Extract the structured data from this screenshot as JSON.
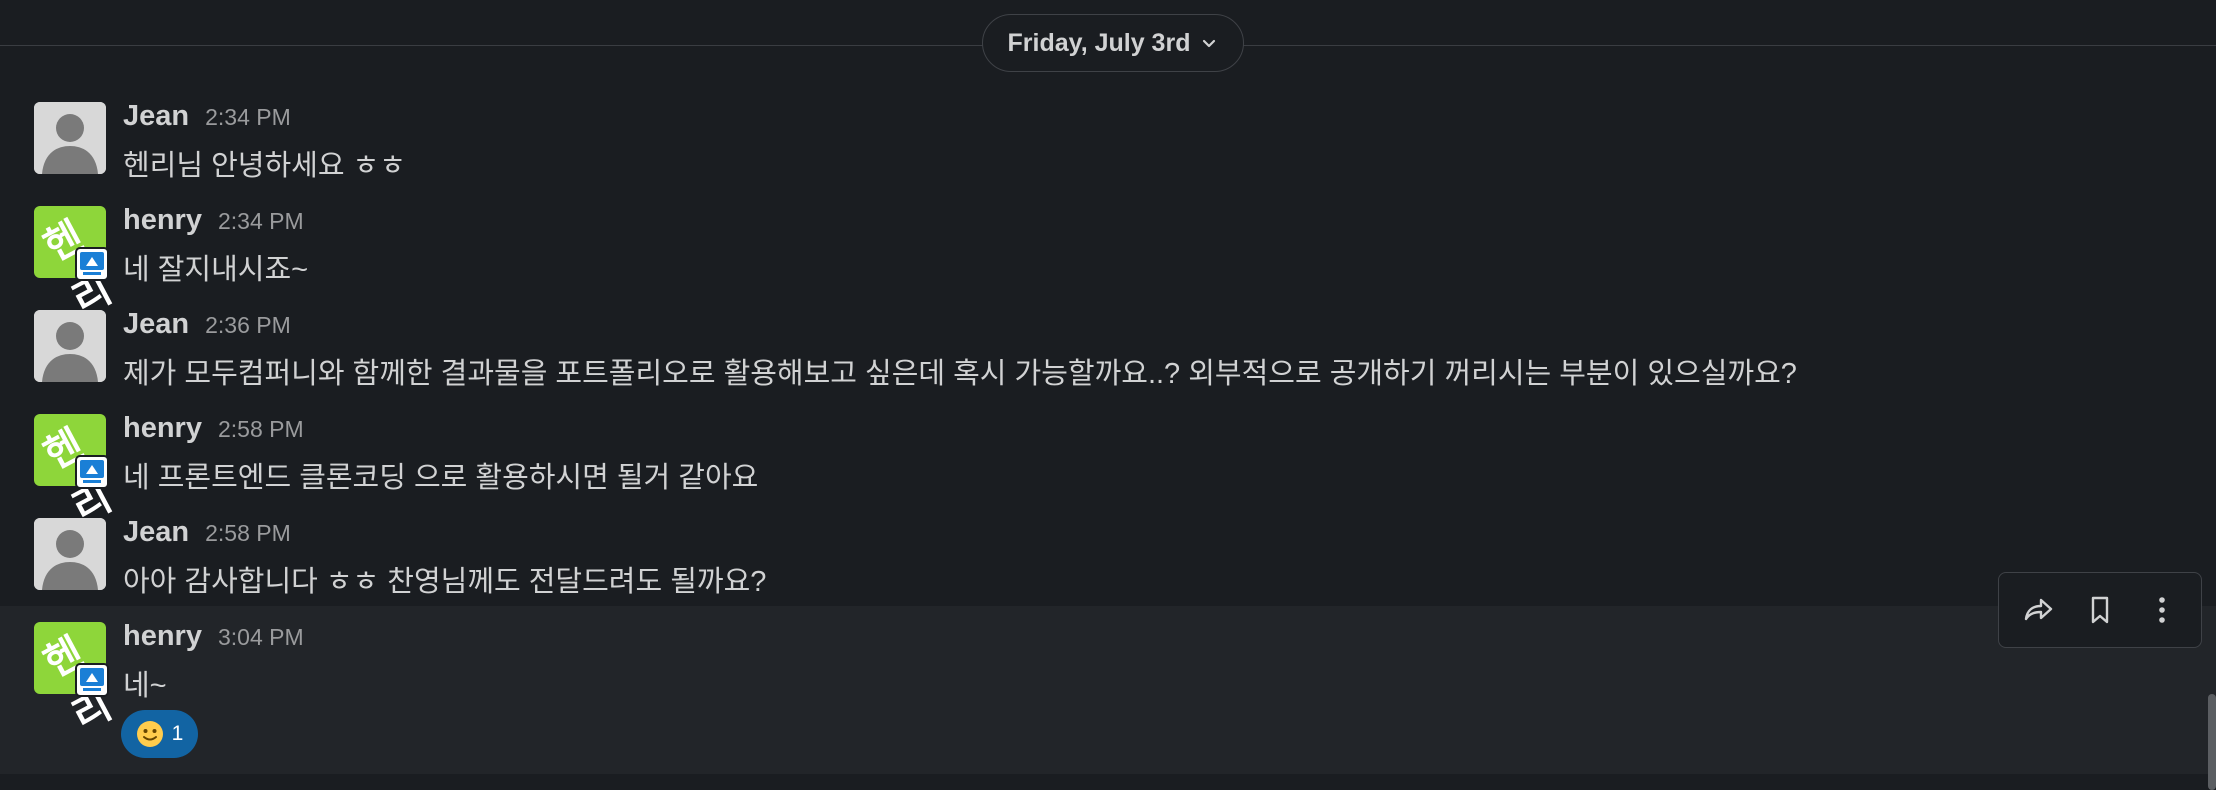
{
  "date_divider": {
    "label": "Friday, July 3rd",
    "icon": "chevron-down-icon"
  },
  "messages": [
    {
      "sender": "Jean",
      "time": "2:34 PM",
      "text": "헨리님 안녕하세요 ㅎㅎ",
      "avatar": "default-user-avatar"
    },
    {
      "sender": "henry",
      "time": "2:34 PM",
      "text": "네 잘지내시죠~",
      "avatar": "henry-logo-avatar"
    },
    {
      "sender": "Jean",
      "time": "2:36 PM",
      "text": "제가 모두컴퍼니와 함께한 결과물을 포트폴리오로 활용해보고 싶은데 혹시 가능할까요..? 외부적으로 공개하기 꺼리시는 부분이 있으실까요?",
      "avatar": "default-user-avatar"
    },
    {
      "sender": "henry",
      "time": "2:58 PM",
      "text": "네 프론트엔드 클론코딩 으로 활용하시면 될거 같아요",
      "avatar": "henry-logo-avatar"
    },
    {
      "sender": "Jean",
      "time": "2:58 PM",
      "text": "아아 감사합니다 ㅎㅎ 찬영님께도 전달드려도 될까요?",
      "avatar": "default-user-avatar"
    },
    {
      "sender": "henry",
      "time": "3:04 PM",
      "text": "네~",
      "avatar": "henry-logo-avatar"
    }
  ],
  "reaction": {
    "emoji": "smiley-face-icon",
    "count": "1"
  },
  "actions": {
    "share": "share-forward-icon",
    "save": "bookmark-icon",
    "more": "more-vertical-icon"
  },
  "avatar_logo_text": "헨리",
  "colors": {
    "background": "#1a1d21",
    "hover_row": "#222529",
    "reaction_bg": "#1264a3",
    "henry_avatar": "#8ed63a",
    "text": "#d1d2d3",
    "timestamp": "#9a9b9d"
  }
}
